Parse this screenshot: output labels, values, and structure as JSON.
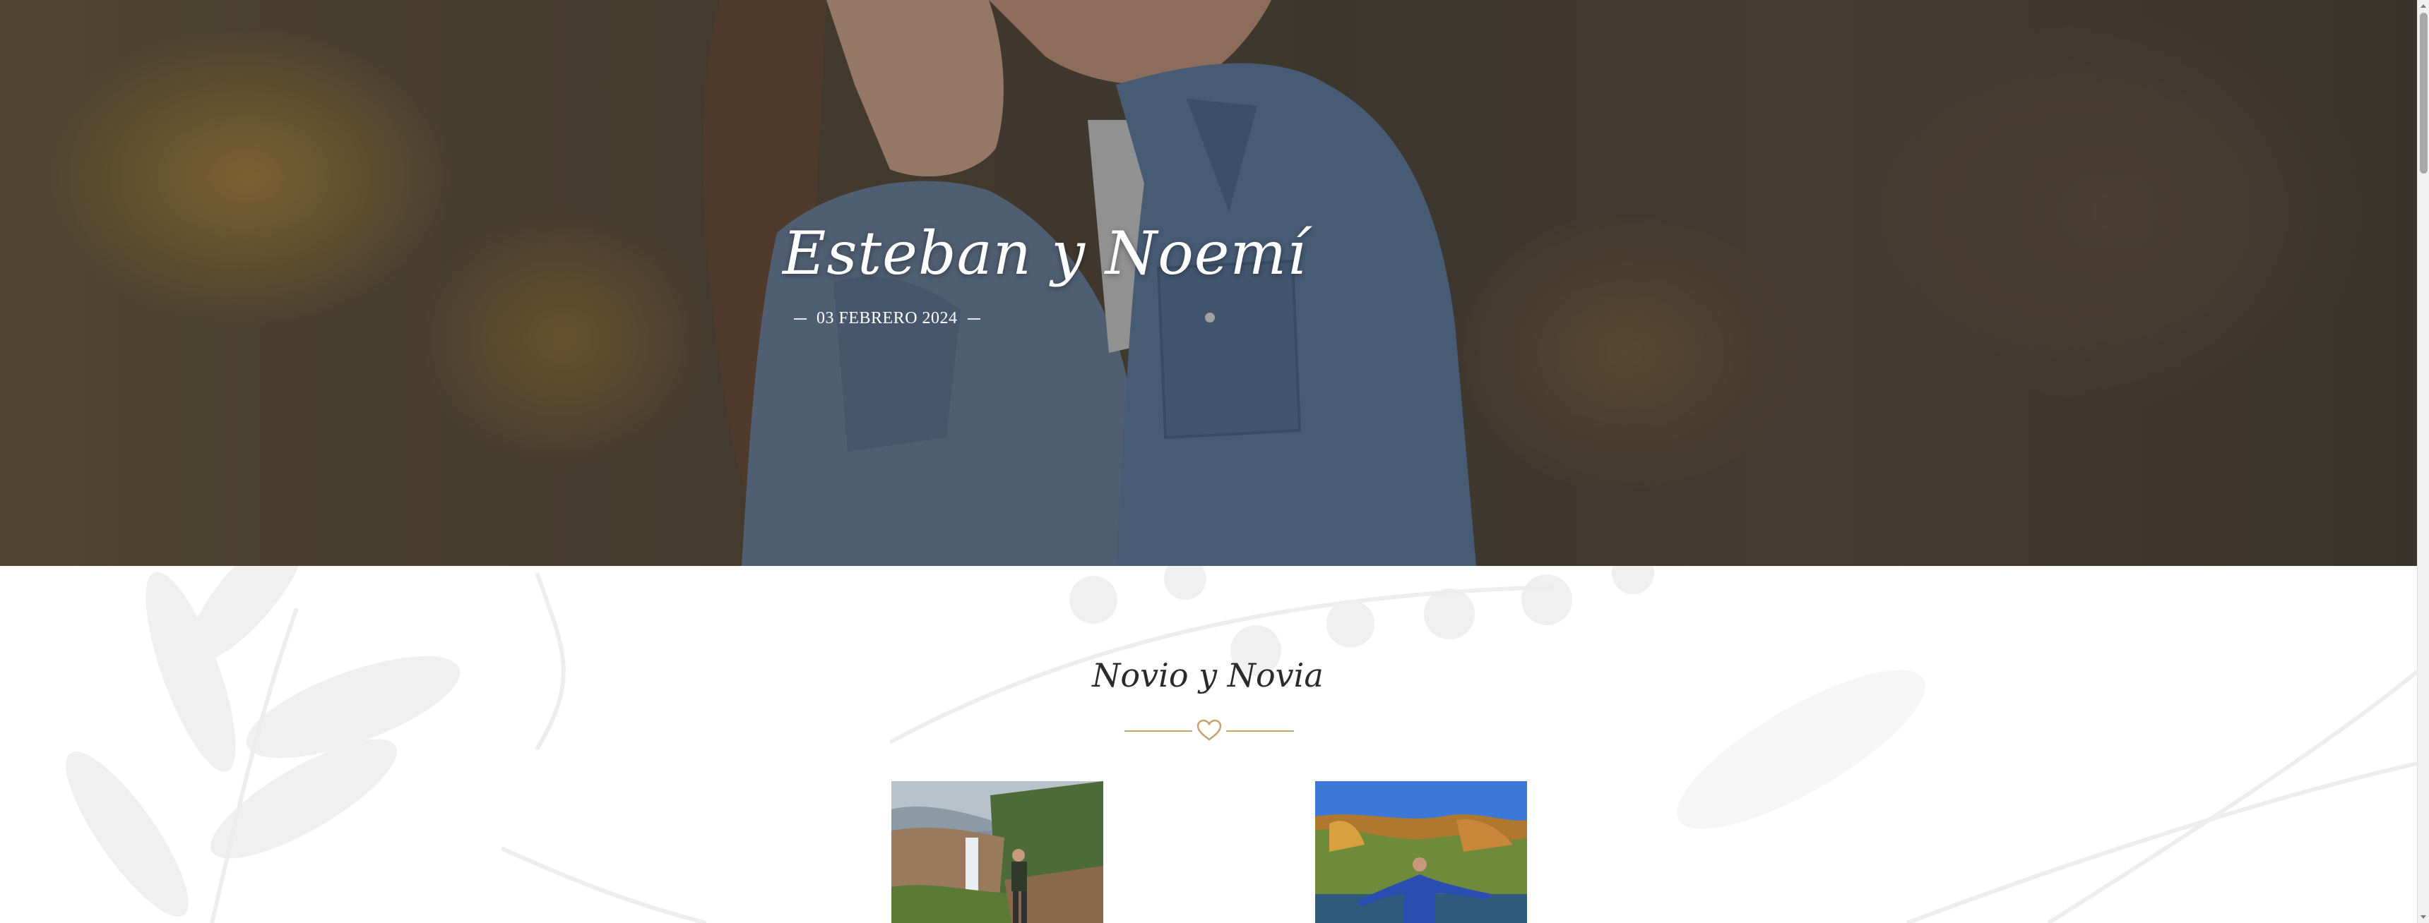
{
  "hero": {
    "title": "Esteban y Noemí",
    "date": "03 FEBRERO 2024"
  },
  "section": {
    "title": "Novio y Novia",
    "divider_icon": "heart-icon",
    "accent_color": "#c9a26b"
  },
  "photos": {
    "groom_alt": "Novio",
    "bride_alt": "Novia"
  }
}
